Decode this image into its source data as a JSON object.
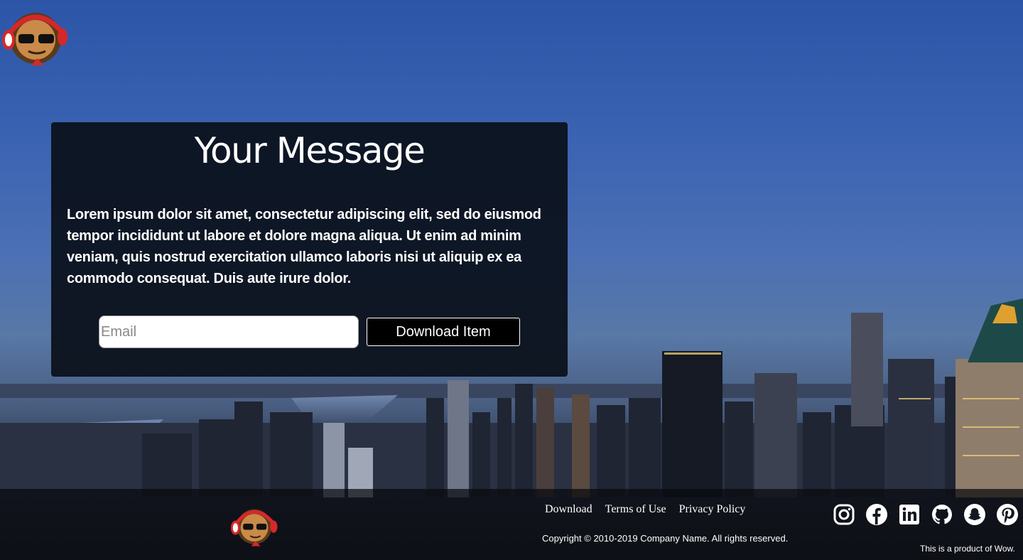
{
  "card": {
    "title": "Your Message",
    "body": "Lorem ipsum dolor sit amet, consectetur adipiscing elit, sed do eiusmod tempor incididunt ut labore et dolore magna aliqua. Ut enim ad minim veniam, quis nostrud exercitation ullamco laboris nisi ut aliquip ex ea commodo consequat. Duis aute irure dolor.",
    "email_placeholder": "Email",
    "email_value": "",
    "button_label": "Download Item"
  },
  "footer": {
    "links": [
      "Download",
      "Terms of Use",
      "Privacy Policy"
    ],
    "copyright": "Copyright © 2010-2019 Company Name. All rights reserved.",
    "product_note": "This is a product of Wow.",
    "social_icons": [
      "instagram-icon",
      "facebook-icon",
      "linkedin-icon",
      "github-icon",
      "snapchat-icon",
      "pinterest-icon"
    ]
  },
  "colors": {
    "card_bg": "#0a101a",
    "button_bg": "#000000",
    "logo_headphones": "#d62828"
  }
}
